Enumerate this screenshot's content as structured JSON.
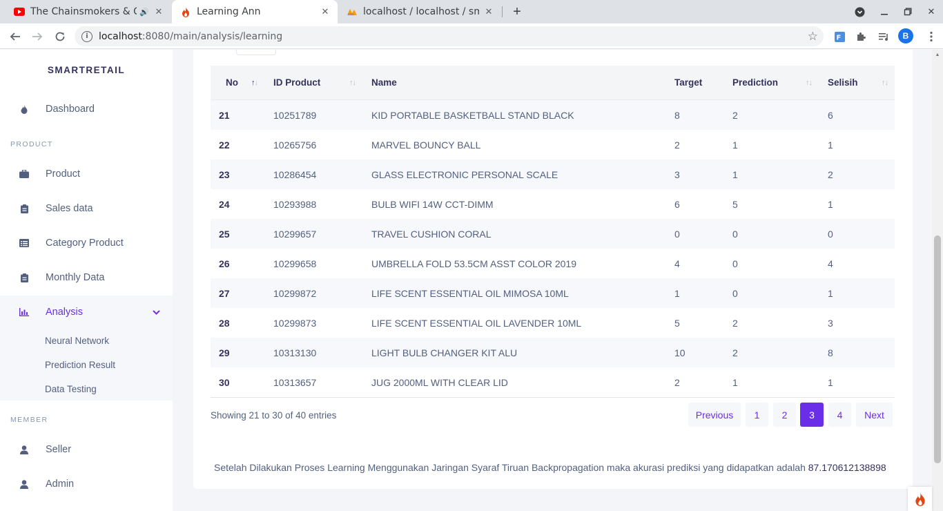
{
  "browser": {
    "tabs": [
      {
        "title": "The Chainsmokers & Co",
        "favicon": "youtube-icon"
      },
      {
        "title": "Learning Ann",
        "favicon": "flame-icon"
      },
      {
        "title": "localhost / localhost / sma",
        "favicon": "phpmyadmin-icon"
      }
    ],
    "url_host": "localhost",
    "url_path": ":8080/main/analysis/learning",
    "avatar_letter": "B"
  },
  "sidebar": {
    "brand": "SMARTRETAIL",
    "dashboard": "Dashboard",
    "heading_product": "PRODUCT",
    "product_items": [
      "Product",
      "Sales data",
      "Category Product",
      "Monthly Data",
      "Analysis"
    ],
    "analysis_sub": [
      "Neural Network",
      "Prediction Result",
      "Data Testing"
    ],
    "heading_member": "MEMBER",
    "member_items": [
      "Seller",
      "Admin"
    ]
  },
  "table": {
    "headers": [
      "No",
      "ID Product",
      "Name",
      "Target",
      "Prediction",
      "Selisih"
    ],
    "rows": [
      [
        "21",
        "10251789",
        "KID PORTABLE BASKETBALL STAND BLACK",
        "8",
        "2",
        "6"
      ],
      [
        "22",
        "10265756",
        "MARVEL BOUNCY BALL",
        "2",
        "1",
        "1"
      ],
      [
        "23",
        "10286454",
        "GLASS ELECTRONIC PERSONAL SCALE",
        "3",
        "1",
        "2"
      ],
      [
        "24",
        "10293988",
        "BULB WIFI 14W CCT-DIMM",
        "6",
        "5",
        "1"
      ],
      [
        "25",
        "10299657",
        "TRAVEL CUSHION CORAL",
        "0",
        "0",
        "0"
      ],
      [
        "26",
        "10299658",
        "UMBRELLA FOLD 53.5CM ASST COLOR 2019",
        "4",
        "0",
        "4"
      ],
      [
        "27",
        "10299872",
        "LIFE SCENT ESSENTIAL OIL MIMOSA 10ML",
        "1",
        "0",
        "1"
      ],
      [
        "28",
        "10299873",
        "LIFE SCENT ESSENTIAL OIL LAVENDER 10ML",
        "5",
        "2",
        "3"
      ],
      [
        "29",
        "10313130",
        "LIGHT BULB CHANGER KIT ALU",
        "10",
        "2",
        "8"
      ],
      [
        "30",
        "10313657",
        "JUG 2000ML WITH CLEAR LID",
        "2",
        "1",
        "1"
      ]
    ]
  },
  "pagination": {
    "info": "Showing 21 to 30 of 40 entries",
    "previous": "Previous",
    "pages": [
      "1",
      "2",
      "3",
      "4"
    ],
    "current": "3",
    "next": "Next"
  },
  "result": {
    "text": "Setelah Dilakukan Proses Learning Menggunakan Jaringan Syaraf Tiruan Backpropagation maka akurasi prediksi yang didapatkan adalah",
    "accuracy": "87.170612138898"
  },
  "colors": {
    "accent": "#6a2ee8",
    "heading": "#32325d",
    "text": "#525f7f"
  }
}
